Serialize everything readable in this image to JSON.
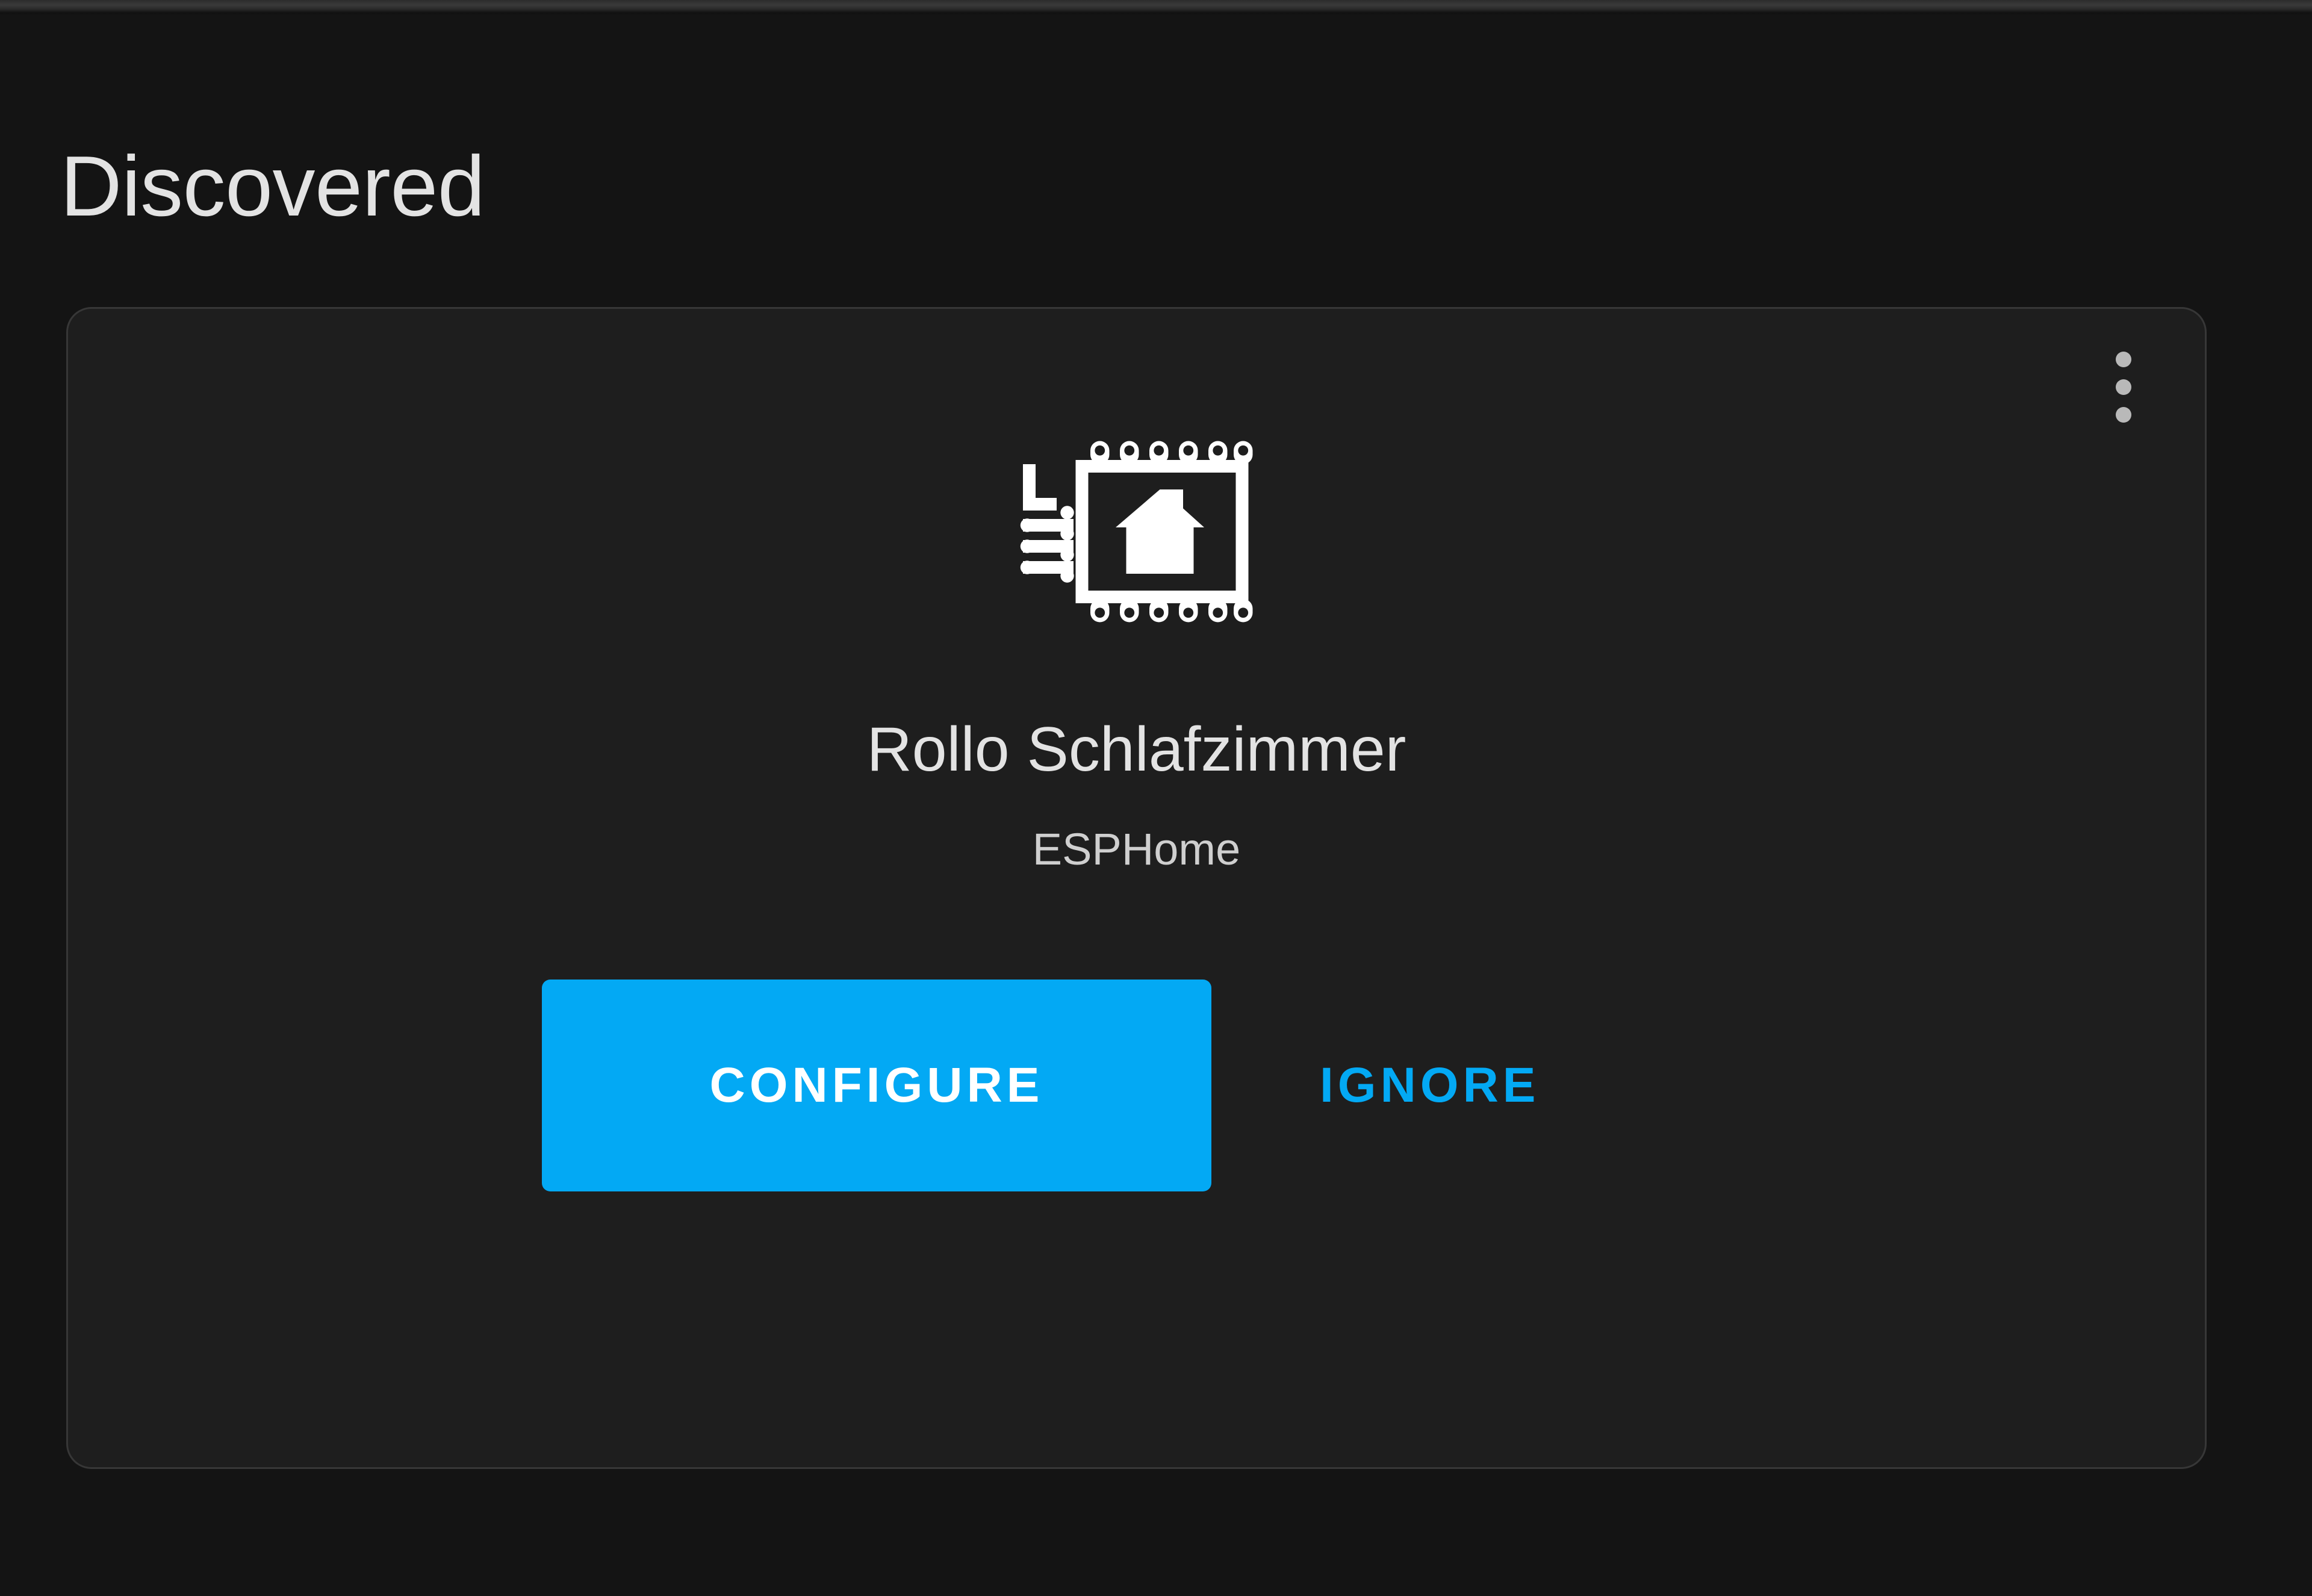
{
  "page": {
    "background_color": "#141414",
    "accent_color": "#03a9f4"
  },
  "section": {
    "heading": "Discovered"
  },
  "card": {
    "background_color": "#1e1e1e",
    "border_color": "#373737",
    "icon_name": "esphome-chip-icon",
    "title": "Rollo Schlafzimmer",
    "subtitle": "ESPHome",
    "overflow_menu": {
      "icon_name": "dots-vertical-icon",
      "dot_count": 3,
      "color": "#b9b9b9"
    },
    "actions": {
      "primary_label": "CONFIGURE",
      "primary_color": "#03a9f4",
      "secondary_label": "IGNORE",
      "secondary_color": "#03a9f4"
    }
  }
}
